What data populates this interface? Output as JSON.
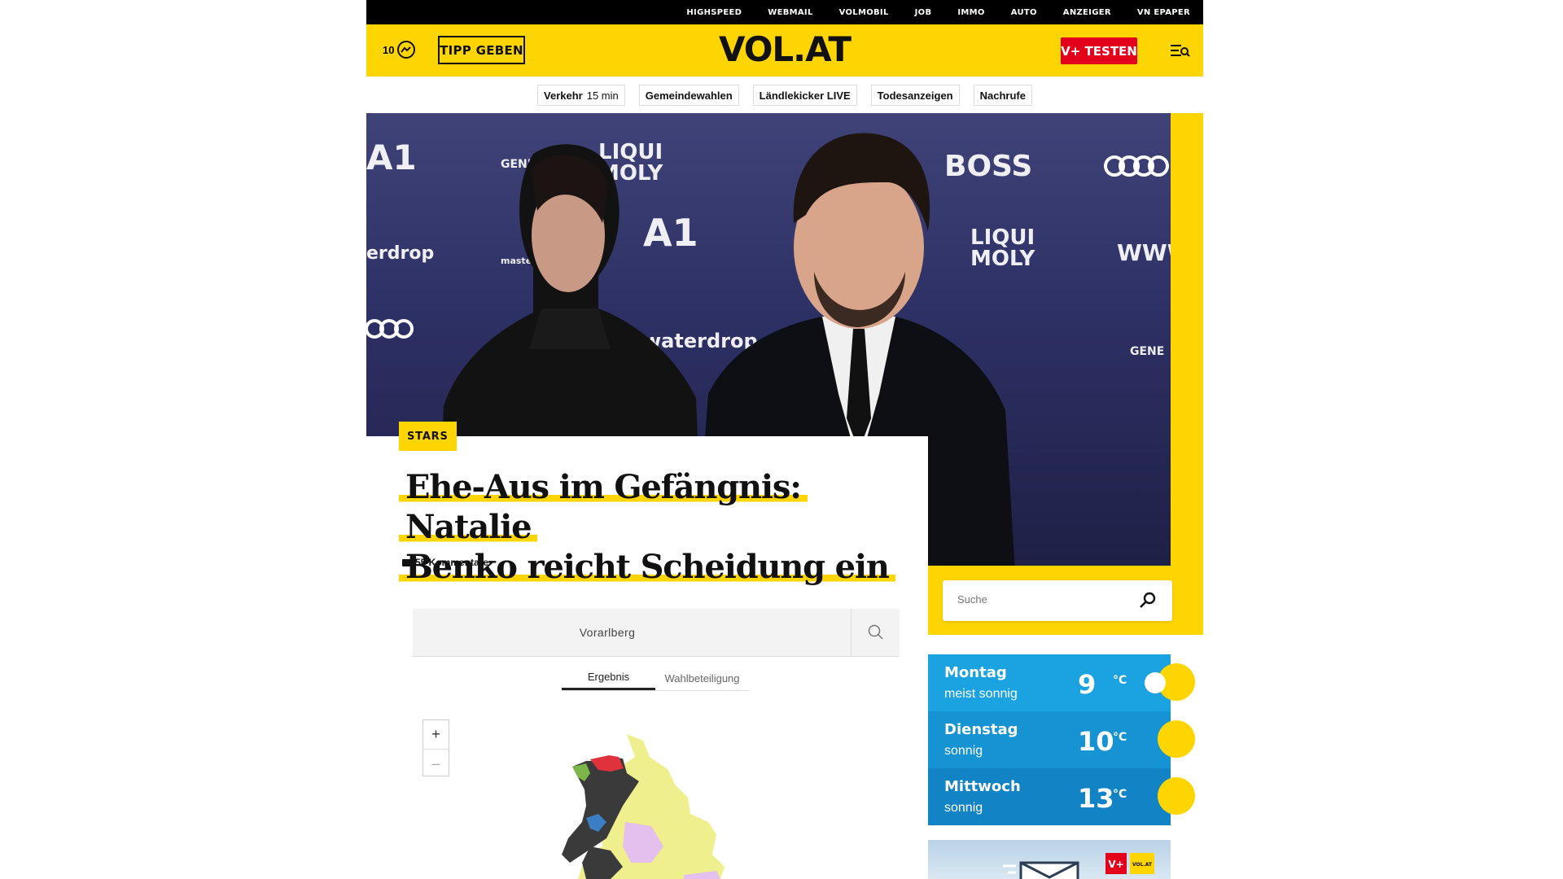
{
  "topnav": [
    "HIGHSPEED",
    "WEBMAIL",
    "VOLMOBIL",
    "JOB",
    "IMMO",
    "AUTO",
    "ANZEIGER",
    "VN EPAPER"
  ],
  "header": {
    "reading_count": "10",
    "tipp_label": "TIPP GEBEN",
    "logo": "VOL.AT",
    "vplus_label": "V+ TESTEN"
  },
  "quicklinks": [
    {
      "label": "Verkehr",
      "extra": "15 min"
    },
    {
      "label": "Gemeindewahlen"
    },
    {
      "label": "Ländlekicker LIVE"
    },
    {
      "label": "Todesanzeigen"
    },
    {
      "label": "Nachrufe"
    }
  ],
  "hero": {
    "sponsors": [
      "BOSS",
      "LIQUI MOLY",
      "waterdrop",
      "mastercard",
      "A1",
      "GENER",
      "erdrop",
      "WWW",
      "LIQUI MOLY",
      "GENE"
    ]
  },
  "article": {
    "category": "STARS",
    "headline_line1": "Ehe-Aus im Gefängnis: Natalie",
    "headline_line2": "Benko reicht Scheidung ein",
    "comments": "55 Kommentare"
  },
  "election": {
    "region": "Vorarlberg",
    "tabs": [
      "Ergebnis",
      "Wahlbeteiligung"
    ],
    "zoom_in": "+",
    "zoom_out": "–"
  },
  "search": {
    "placeholder": "Suche"
  },
  "weather": [
    {
      "day": "Montag",
      "desc": "meist sonnig",
      "temp": "9",
      "unit": "°C",
      "color": "#1aa3e0"
    },
    {
      "day": "Dienstag",
      "desc": "sonnig",
      "temp": "10",
      "unit": "°C",
      "color": "#1593d3"
    },
    {
      "day": "Mittwoch",
      "desc": "sonnig",
      "temp": "13",
      "unit": "°C",
      "color": "#1283c4"
    }
  ],
  "colors": {
    "brand_yellow": "#ffd500",
    "brand_red": "#e2001a",
    "black": "#000000"
  }
}
